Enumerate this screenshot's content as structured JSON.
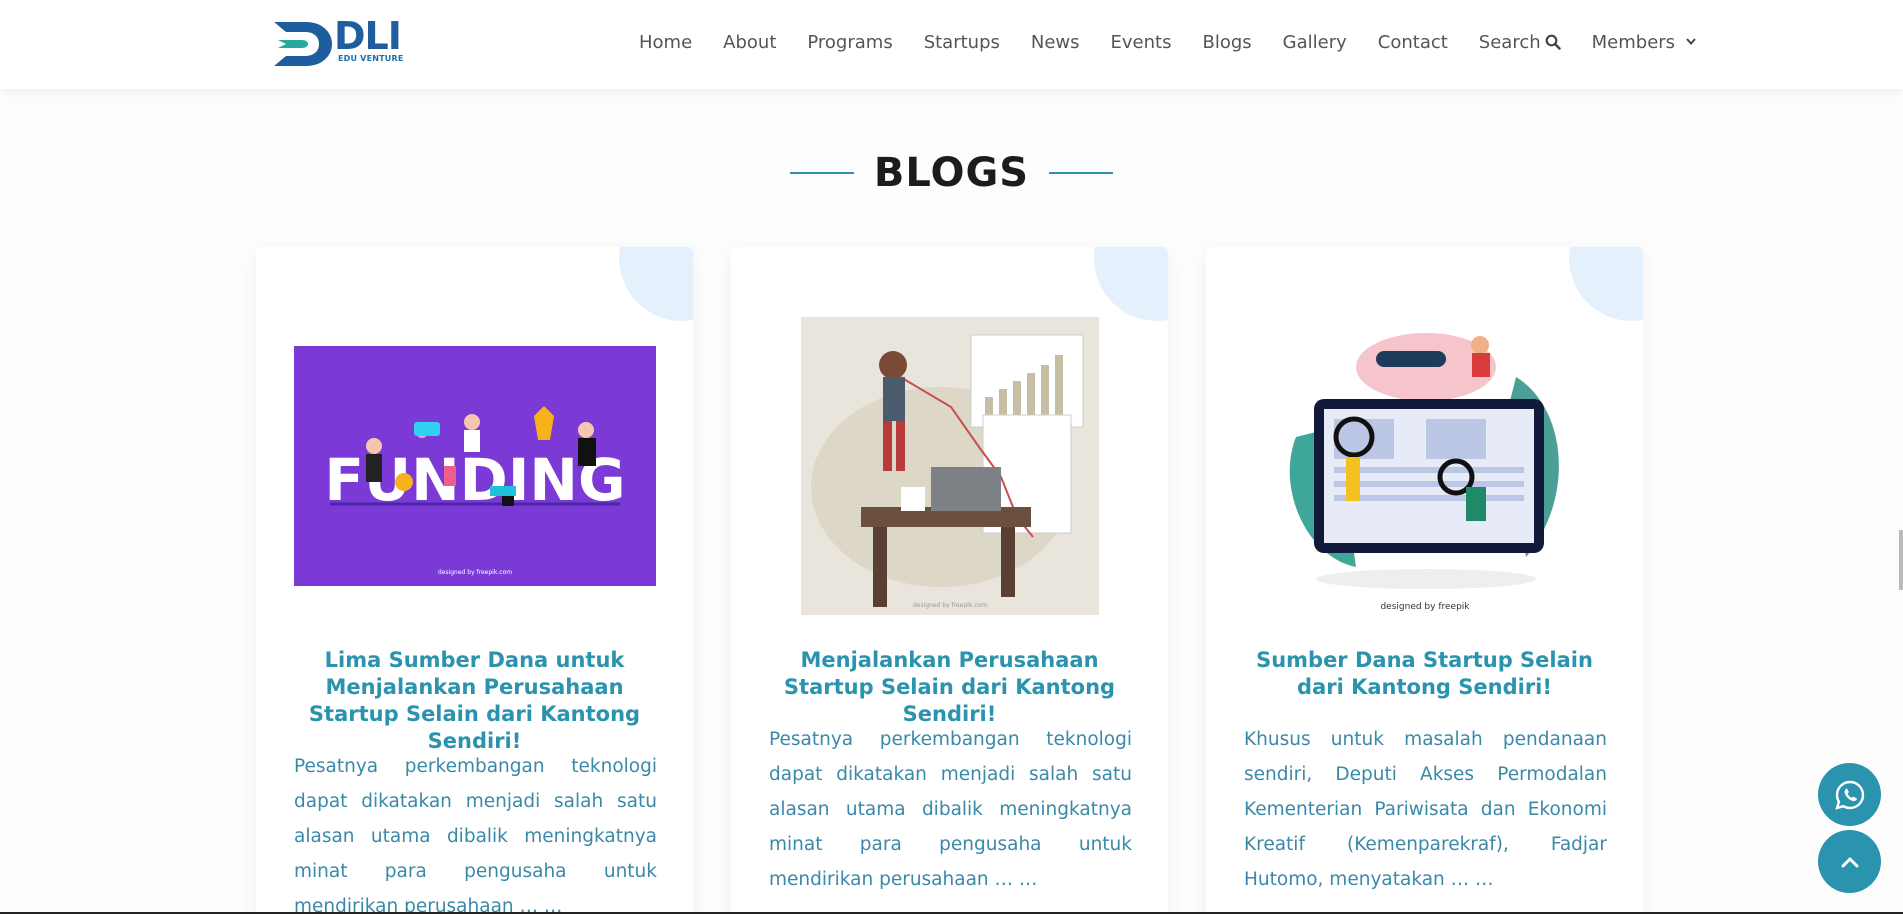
{
  "logo": {
    "main": "DLI",
    "sub": "EDU VENTURE"
  },
  "nav": {
    "items": [
      "Home",
      "About",
      "Programs",
      "Startups",
      "News",
      "Events",
      "Blogs",
      "Gallery",
      "Contact"
    ],
    "search_label": "Search",
    "members_label": "Members"
  },
  "section": {
    "title": "BLOGS"
  },
  "cards": [
    {
      "title": "Lima Sumber Dana untuk Menjalankan Perusahaan Startup Selain dari Kantong Sendiri!",
      "text": "Pesatnya perkembangan teknologi dapat dikatakan menjadi salah satu alasan utama dibalik meningkatnya minat para pengusaha untuk mendirikan perusahaan … …",
      "image_word": "FUNDING",
      "image_credit": "designed by freepik.com"
    },
    {
      "title": "Menjalankan Perusahaan Startup Selain dari Kantong Sendiri!",
      "text": "Pesatnya perkembangan teknologi dapat dikatakan menjadi salah satu alasan utama dibalik meningkatnya minat para pengusaha untuk mendirikan perusahaan … …",
      "image_credit": "designed by freepik.com"
    },
    {
      "title": "Sumber Dana Startup Selain dari Kantong Sendiri!",
      "text": "Khusus untuk masalah pendanaan sendiri, Deputi Akses Permodalan Kementerian Pariwisata dan Ekonomi Kreatif (Kemenparekraf), Fadjar Hutomo, menyatakan … …",
      "image_credit": "designed by freepik"
    }
  ],
  "colors": {
    "accent": "#2a93ae",
    "title_dark": "#1c1c1c",
    "card_corner": "#e4f0fb",
    "funding_bg": "#7b3ad6"
  },
  "icons": {
    "search": "search-icon",
    "members": "chevron-down-icon",
    "whatsapp": "whatsapp-icon",
    "scroll_top": "chevron-up-icon"
  }
}
